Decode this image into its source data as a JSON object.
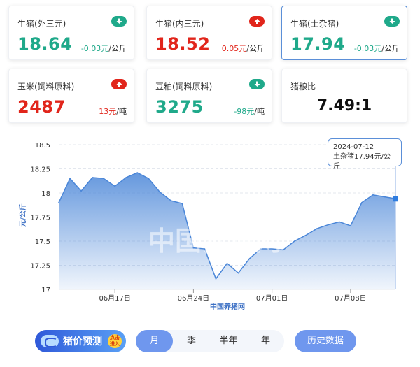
{
  "cards": [
    {
      "title": "生猪(外三元)",
      "price": "18.64",
      "change": "-0.03元",
      "unit": "/公斤",
      "direction": "down"
    },
    {
      "title": "生猪(内三元)",
      "price": "18.52",
      "change": "0.05元",
      "unit": "/公斤",
      "direction": "up"
    },
    {
      "title": "生猪(土杂猪)",
      "price": "17.94",
      "change": "-0.03元",
      "unit": "/公斤",
      "direction": "down",
      "active": true
    },
    {
      "title": "玉米(饲料原料)",
      "price": "2487",
      "change": "13元",
      "unit": "/吨",
      "direction": "up"
    },
    {
      "title": "豆粕(饲料原料)",
      "price": "3275",
      "change": "-98元",
      "unit": "/吨",
      "direction": "down"
    },
    {
      "title": "猪粮比",
      "ratio": "7.49:1"
    }
  ],
  "colors": {
    "up": "#e1251b",
    "down": "#1fa98a",
    "accent": "#6f97ee",
    "line": "#4a86d8"
  },
  "chart": {
    "ylabel": "元/公斤",
    "xlabel": "中国养猪网",
    "watermark": "中国养猪网",
    "ylim": [
      17,
      18.5
    ],
    "y_ticks": [
      "17",
      "17.25",
      "17.5",
      "17.75",
      "18",
      "18.25",
      "18.5"
    ],
    "x_ticks": [
      "06月17日",
      "06月24日",
      "07月01日",
      "07月08日"
    ]
  },
  "tooltip": {
    "date": "2024-07-12",
    "label": "土杂猪17.94元/公斤"
  },
  "chart_data": {
    "type": "area",
    "series": [
      {
        "name": "土杂猪",
        "x": [
          "2024-06-12",
          "2024-06-13",
          "2024-06-14",
          "2024-06-15",
          "2024-06-16",
          "2024-06-17",
          "2024-06-18",
          "2024-06-19",
          "2024-06-20",
          "2024-06-21",
          "2024-06-22",
          "2024-06-23",
          "2024-06-24",
          "2024-06-25",
          "2024-06-26",
          "2024-06-27",
          "2024-06-28",
          "2024-06-29",
          "2024-06-30",
          "2024-07-01",
          "2024-07-02",
          "2024-07-03",
          "2024-07-04",
          "2024-07-05",
          "2024-07-06",
          "2024-07-07",
          "2024-07-08",
          "2024-07-09",
          "2024-07-10",
          "2024-07-11",
          "2024-07-12"
        ],
        "values": [
          17.9,
          18.15,
          18.02,
          18.16,
          18.15,
          18.07,
          18.16,
          18.21,
          18.15,
          18.01,
          17.92,
          17.89,
          17.43,
          17.42,
          17.11,
          17.27,
          17.17,
          17.32,
          17.42,
          17.42,
          17.41,
          17.5,
          17.56,
          17.63,
          17.67,
          17.7,
          17.66,
          17.9,
          17.98,
          17.96,
          17.94
        ]
      }
    ],
    "xlabel": "中国养猪网",
    "ylabel": "元/公斤",
    "ylim": [
      17,
      18.5
    ],
    "grid": true,
    "legend": "none"
  },
  "controls": {
    "predict_label": "猪价预测",
    "predict_tag": "点击进入",
    "periods": [
      "月",
      "季",
      "半年",
      "年"
    ],
    "active_period": "月",
    "history_label": "历史数据"
  }
}
